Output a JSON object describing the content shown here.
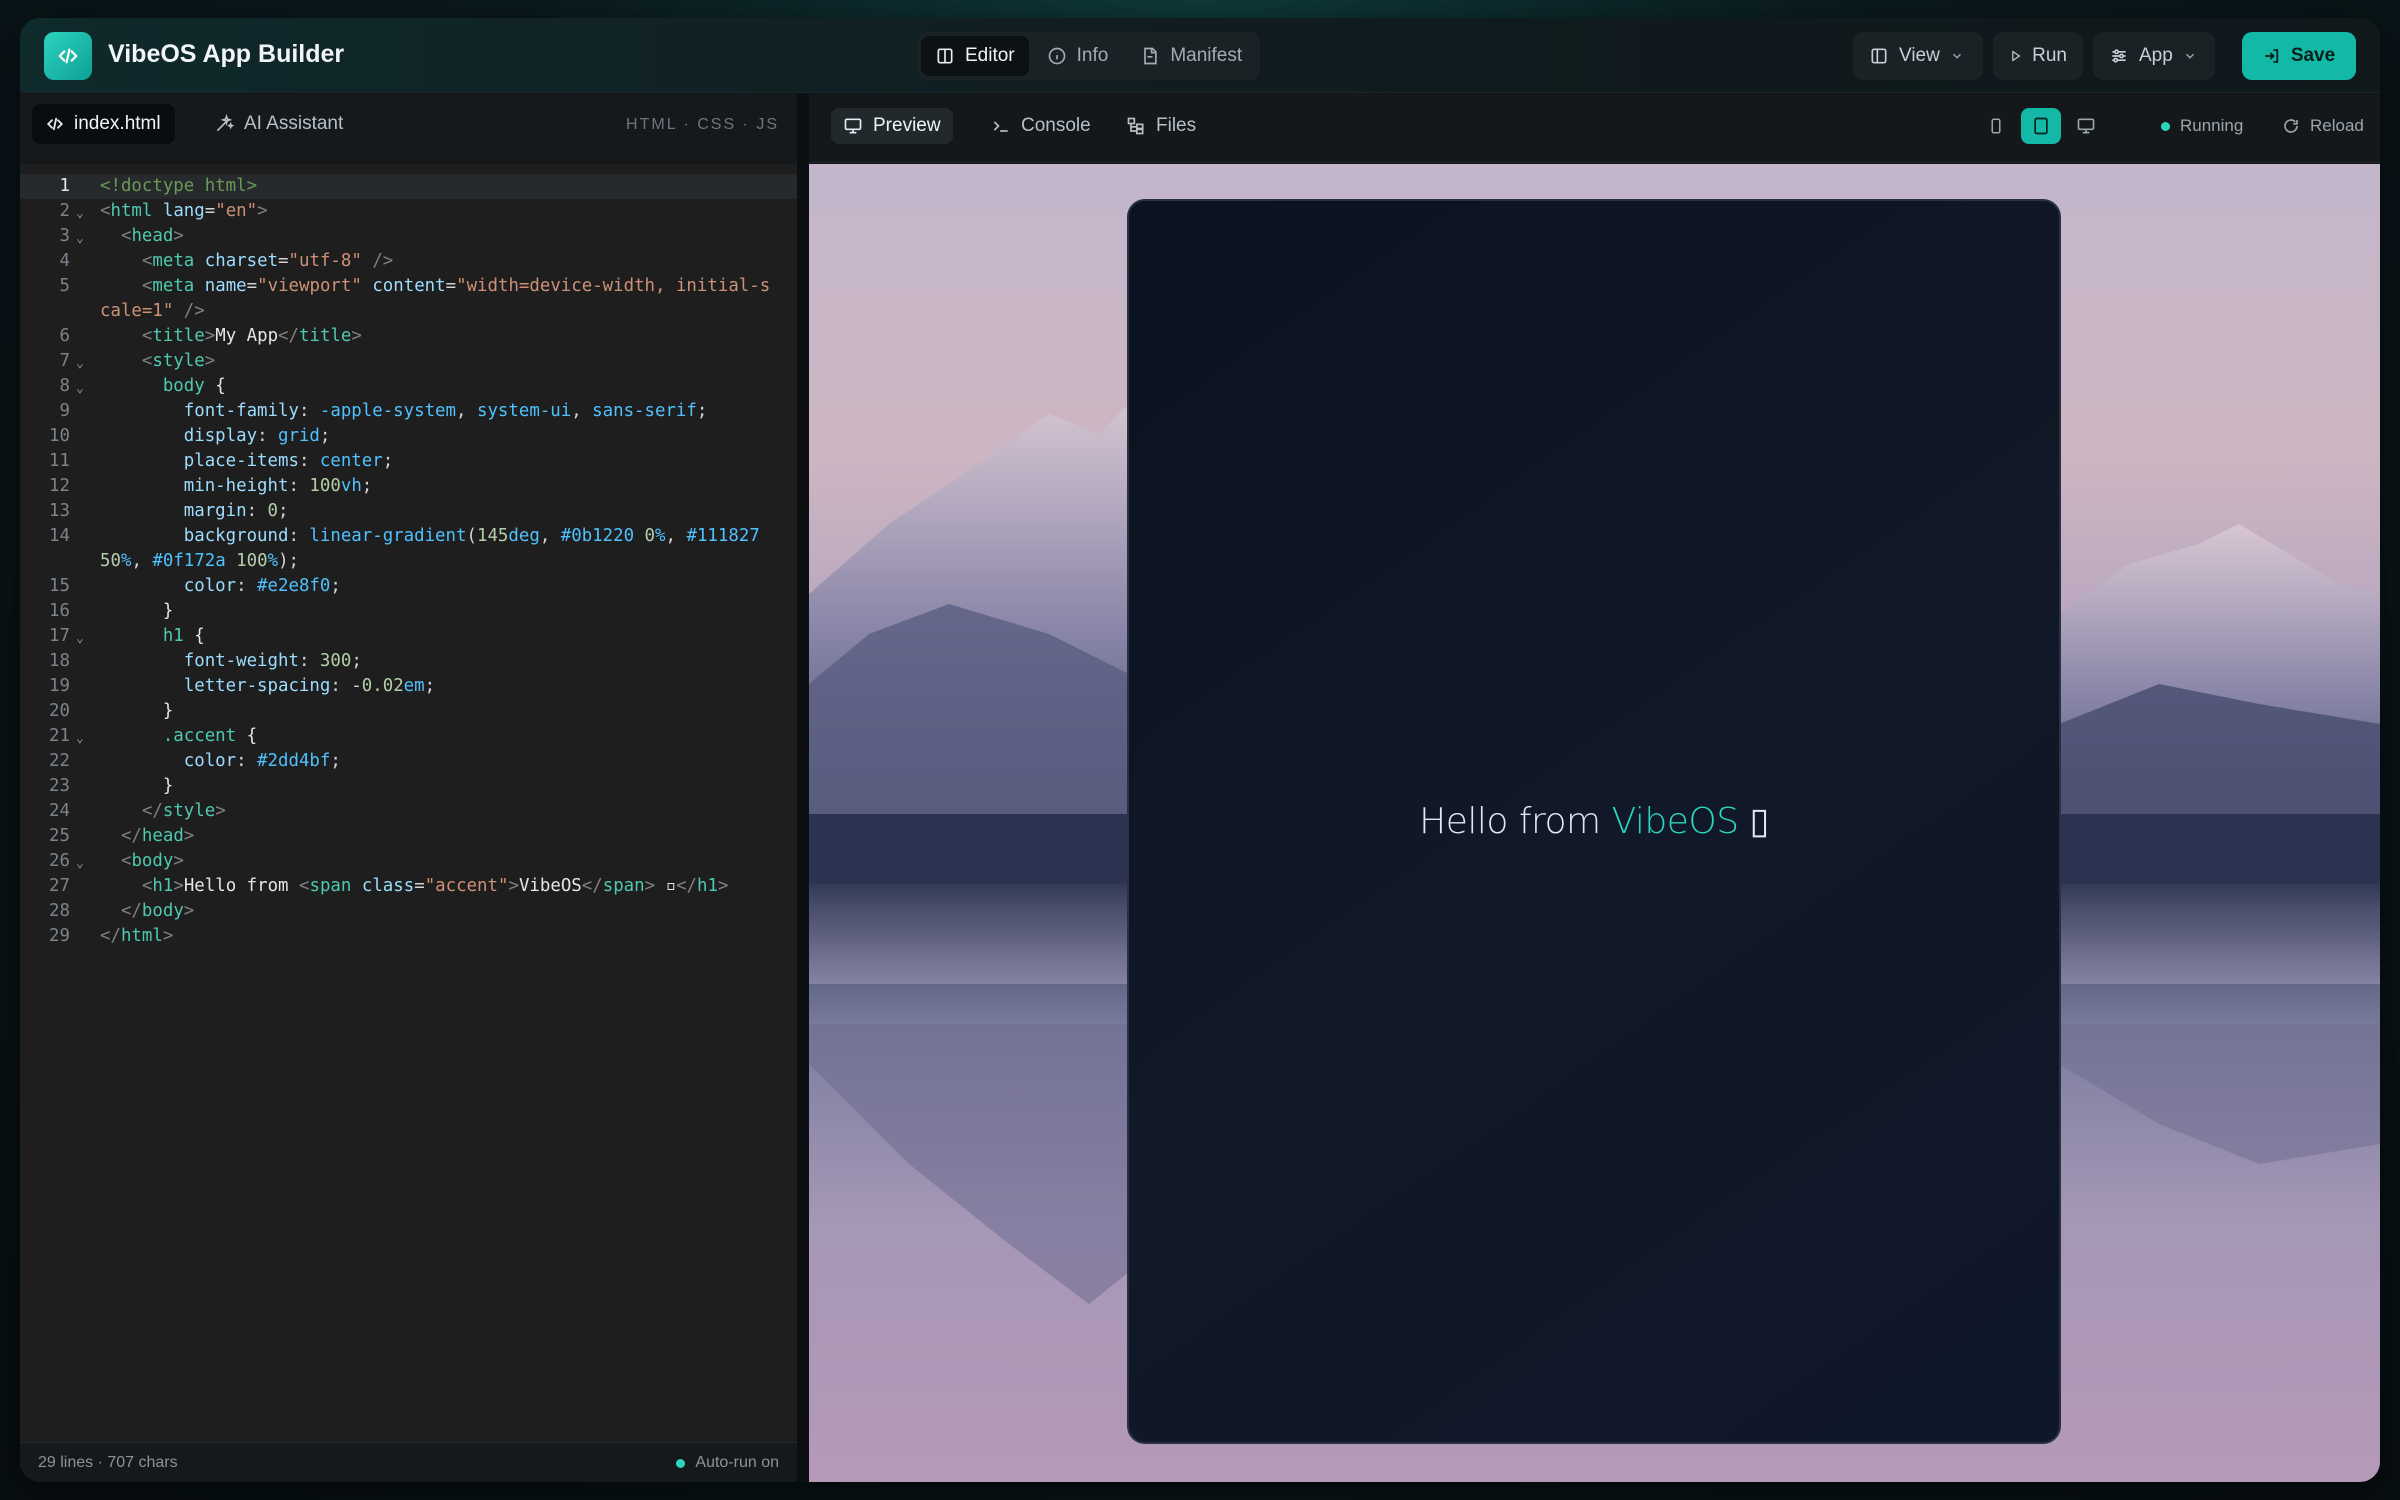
{
  "header": {
    "title": "VibeOS App Builder",
    "tabs": [
      {
        "label": "Editor",
        "icon": "columns-icon"
      },
      {
        "label": "Info",
        "icon": "info-icon"
      },
      {
        "label": "Manifest",
        "icon": "file-icon"
      }
    ],
    "view_label": "View",
    "run_label": "Run",
    "app_label": "App",
    "save_label": "Save"
  },
  "editor": {
    "tabs": [
      {
        "label": "index.html",
        "icon": "code-icon"
      },
      {
        "label": "AI Assistant",
        "icon": "sparkles-icon"
      }
    ],
    "languages": "HTML · CSS · JS",
    "stats": "29 lines · 707 chars",
    "autorun": "Auto-run on",
    "current_line": 1
  },
  "preview": {
    "tabs": [
      {
        "label": "Preview",
        "icon": "monitor-icon"
      },
      {
        "label": "Console",
        "icon": "terminal-icon"
      },
      {
        "label": "Files",
        "icon": "files-icon"
      }
    ],
    "devices": [
      "phone-icon",
      "tablet-icon",
      "desktop-icon"
    ],
    "active_device": "tablet-icon",
    "status": "Running",
    "reload_label": "Reload",
    "hello_text": "Hello from ",
    "hello_accent": "VibeOS",
    "hello_emoji": "▯"
  },
  "colors": {
    "accent": "#2dd4bf",
    "save_bg": "#14b8a6"
  }
}
